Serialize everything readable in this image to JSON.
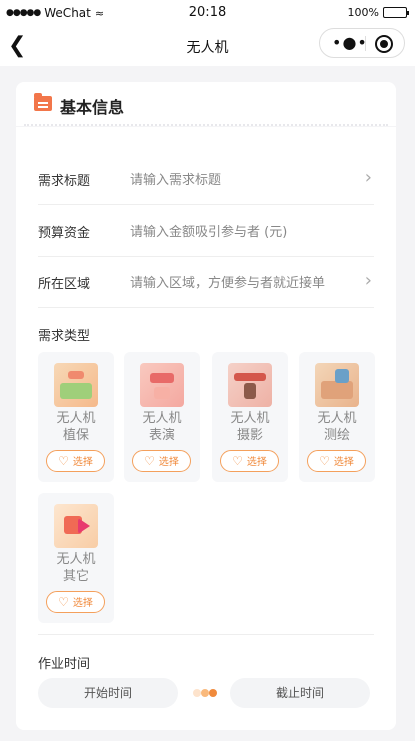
{
  "status": {
    "carrier": "WeChat",
    "time": "20:18",
    "battery": "100%"
  },
  "nav": {
    "title": "无人机"
  },
  "section": {
    "title": "基本信息"
  },
  "fields": [
    {
      "label": "需求标题",
      "placeholder": "请输入需求标题",
      "has_chevron": true
    },
    {
      "label": "预算资金",
      "placeholder": "请输入金额吸引参与者 (元)",
      "has_chevron": false
    },
    {
      "label": "所在区域",
      "placeholder": "请输入区域，方便参与者就近接单",
      "has_chevron": true
    }
  ],
  "demand_type": {
    "label": "需求类型",
    "select_label": "选择",
    "items": [
      {
        "line1": "无人机",
        "line2": "植保"
      },
      {
        "line1": "无人机",
        "line2": "表演"
      },
      {
        "line1": "无人机",
        "line2": "摄影"
      },
      {
        "line1": "无人机",
        "line2": "测绘"
      },
      {
        "line1": "无人机",
        "line2": "其它"
      }
    ]
  },
  "work_time": {
    "label": "作业时间",
    "start": "开始时间",
    "end": "截止时间"
  },
  "colors": {
    "accent": "#f08a3c",
    "folder": "#f2764a",
    "card_bg": "#f6f7f9"
  }
}
